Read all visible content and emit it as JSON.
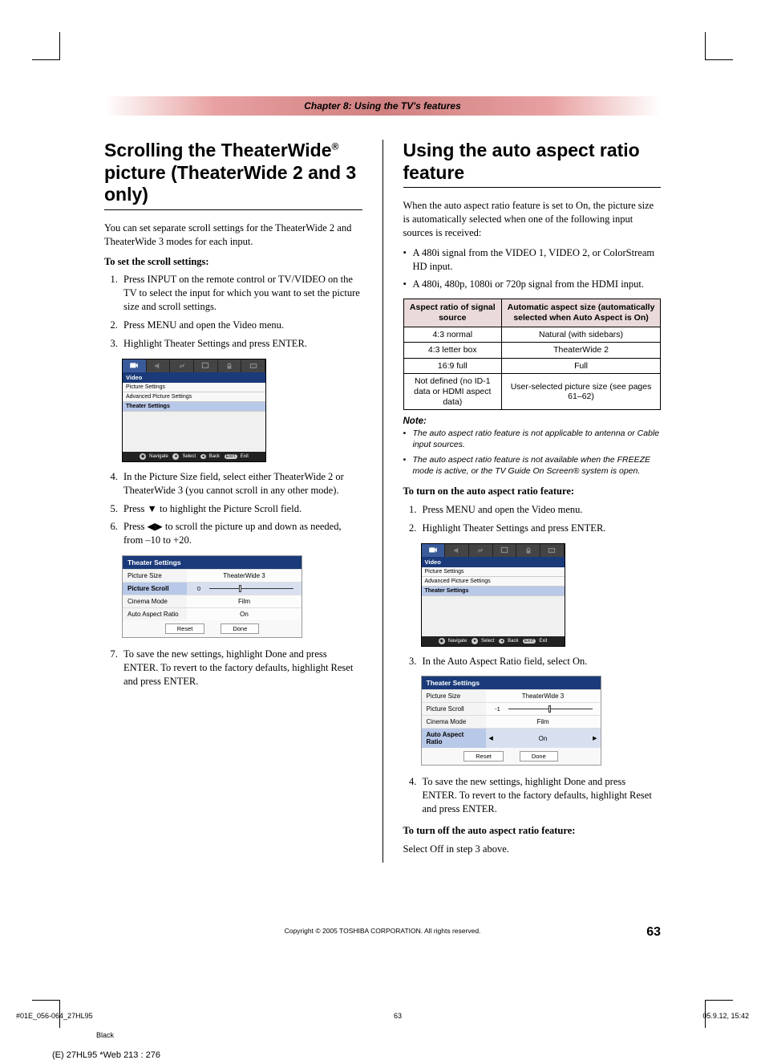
{
  "chapter_bar": "Chapter 8: Using the TV's features",
  "left": {
    "title_a": "Scrolling the TheaterWide",
    "title_sup": "®",
    "title_b": " picture (TheaterWide 2 and 3 only)",
    "intro": "You can set separate scroll settings for the TheaterWide 2 and TheaterWide 3 modes for each input.",
    "to_set": "To set the scroll settings:",
    "steps_a": [
      "Press INPUT on the remote control or TV/VIDEO on the TV to select the input for which you want to set the picture size and scroll settings.",
      "Press MENU and open the Video menu.",
      "Highlight Theater Settings and press ENTER."
    ],
    "steps_b": [
      "In the Picture Size field, select either TheaterWide 2 or TheaterWide 3 (you cannot scroll in any other mode).",
      "Press ▼ to highlight the Picture Scroll field.",
      "Press ◀▶ to scroll the picture up and down as needed, from –10 to +20."
    ],
    "steps_c": [
      "To save the new settings, highlight Done and press ENTER. To revert to the factory defaults, highlight Reset and press ENTER."
    ],
    "osd": {
      "title": "Video",
      "items": [
        "Picture Settings",
        "Advanced Picture Settings",
        "Theater Settings"
      ],
      "footer": [
        "Navigate",
        "Select",
        "Back",
        "Exit"
      ]
    },
    "ts": {
      "header": "Theater Settings",
      "rows": [
        {
          "label": "Picture Size",
          "val": "TheaterWide 3"
        },
        {
          "label": "Picture Scroll",
          "val": "0",
          "slider": true,
          "sel": true,
          "thumb": 35
        },
        {
          "label": "Cinema Mode",
          "val": "Film"
        },
        {
          "label": "Auto Aspect Ratio",
          "val": "On"
        }
      ],
      "reset": "Reset",
      "done": "Done"
    }
  },
  "right": {
    "title": "Using the auto aspect ratio feature",
    "intro": "When the auto aspect ratio feature is set to On, the picture size is automatically selected when one of the following input sources is received:",
    "bullets": [
      "A 480i signal from the VIDEO 1, VIDEO 2, or ColorStream HD input.",
      "A 480i, 480p, 1080i or 720p signal from the HDMI input."
    ],
    "table": {
      "h1": "Aspect ratio of signal source",
      "h2": "Automatic aspect size (automatically selected when Auto Aspect is On)",
      "rows": [
        [
          "4:3 normal",
          "Natural (with sidebars)"
        ],
        [
          "4:3 letter box",
          "TheaterWide 2"
        ],
        [
          "16:9 full",
          "Full"
        ],
        [
          "Not defined (no ID-1 data or HDMI aspect data)",
          "User-selected picture size (see pages 61–62)"
        ]
      ]
    },
    "note_heading": "Note:",
    "notes": [
      "The auto aspect ratio feature is not applicable to antenna or Cable input sources.",
      "The auto aspect ratio feature is not available when the FREEZE mode is active, or the TV Guide On Screen® system is open."
    ],
    "to_on": "To turn on the auto aspect ratio feature:",
    "steps_on_a": [
      "Press MENU and open the Video menu.",
      "Highlight Theater Settings and press ENTER."
    ],
    "steps_on_b": [
      "In the Auto Aspect Ratio field, select On."
    ],
    "steps_on_c": [
      "To save the new settings, highlight Done and press ENTER. To revert to the factory defaults, highlight Reset and press ENTER."
    ],
    "ts": {
      "header": "Theater Settings",
      "rows": [
        {
          "label": "Picture Size",
          "val": "TheaterWide 3"
        },
        {
          "label": "Picture Scroll",
          "val": "-1",
          "slider": true,
          "thumb": 48
        },
        {
          "label": "Cinema Mode",
          "val": "Film"
        },
        {
          "label": "Auto Aspect Ratio",
          "val": "On",
          "sel": true,
          "arrows": true
        }
      ],
      "reset": "Reset",
      "done": "Done"
    },
    "to_off": "To turn off the auto aspect ratio feature:",
    "off_text": "Select Off in step 3 above."
  },
  "footer": {
    "copyright": "Copyright © 2005 TOSHIBA CORPORATION. All rights reserved.",
    "page": "63",
    "file": "#01E_056-064_27HL95",
    "filepage": "63",
    "date": "05.9.12, 15:42",
    "color": "Black",
    "web": "(E) 27HL95 *Web 213 : 276"
  }
}
